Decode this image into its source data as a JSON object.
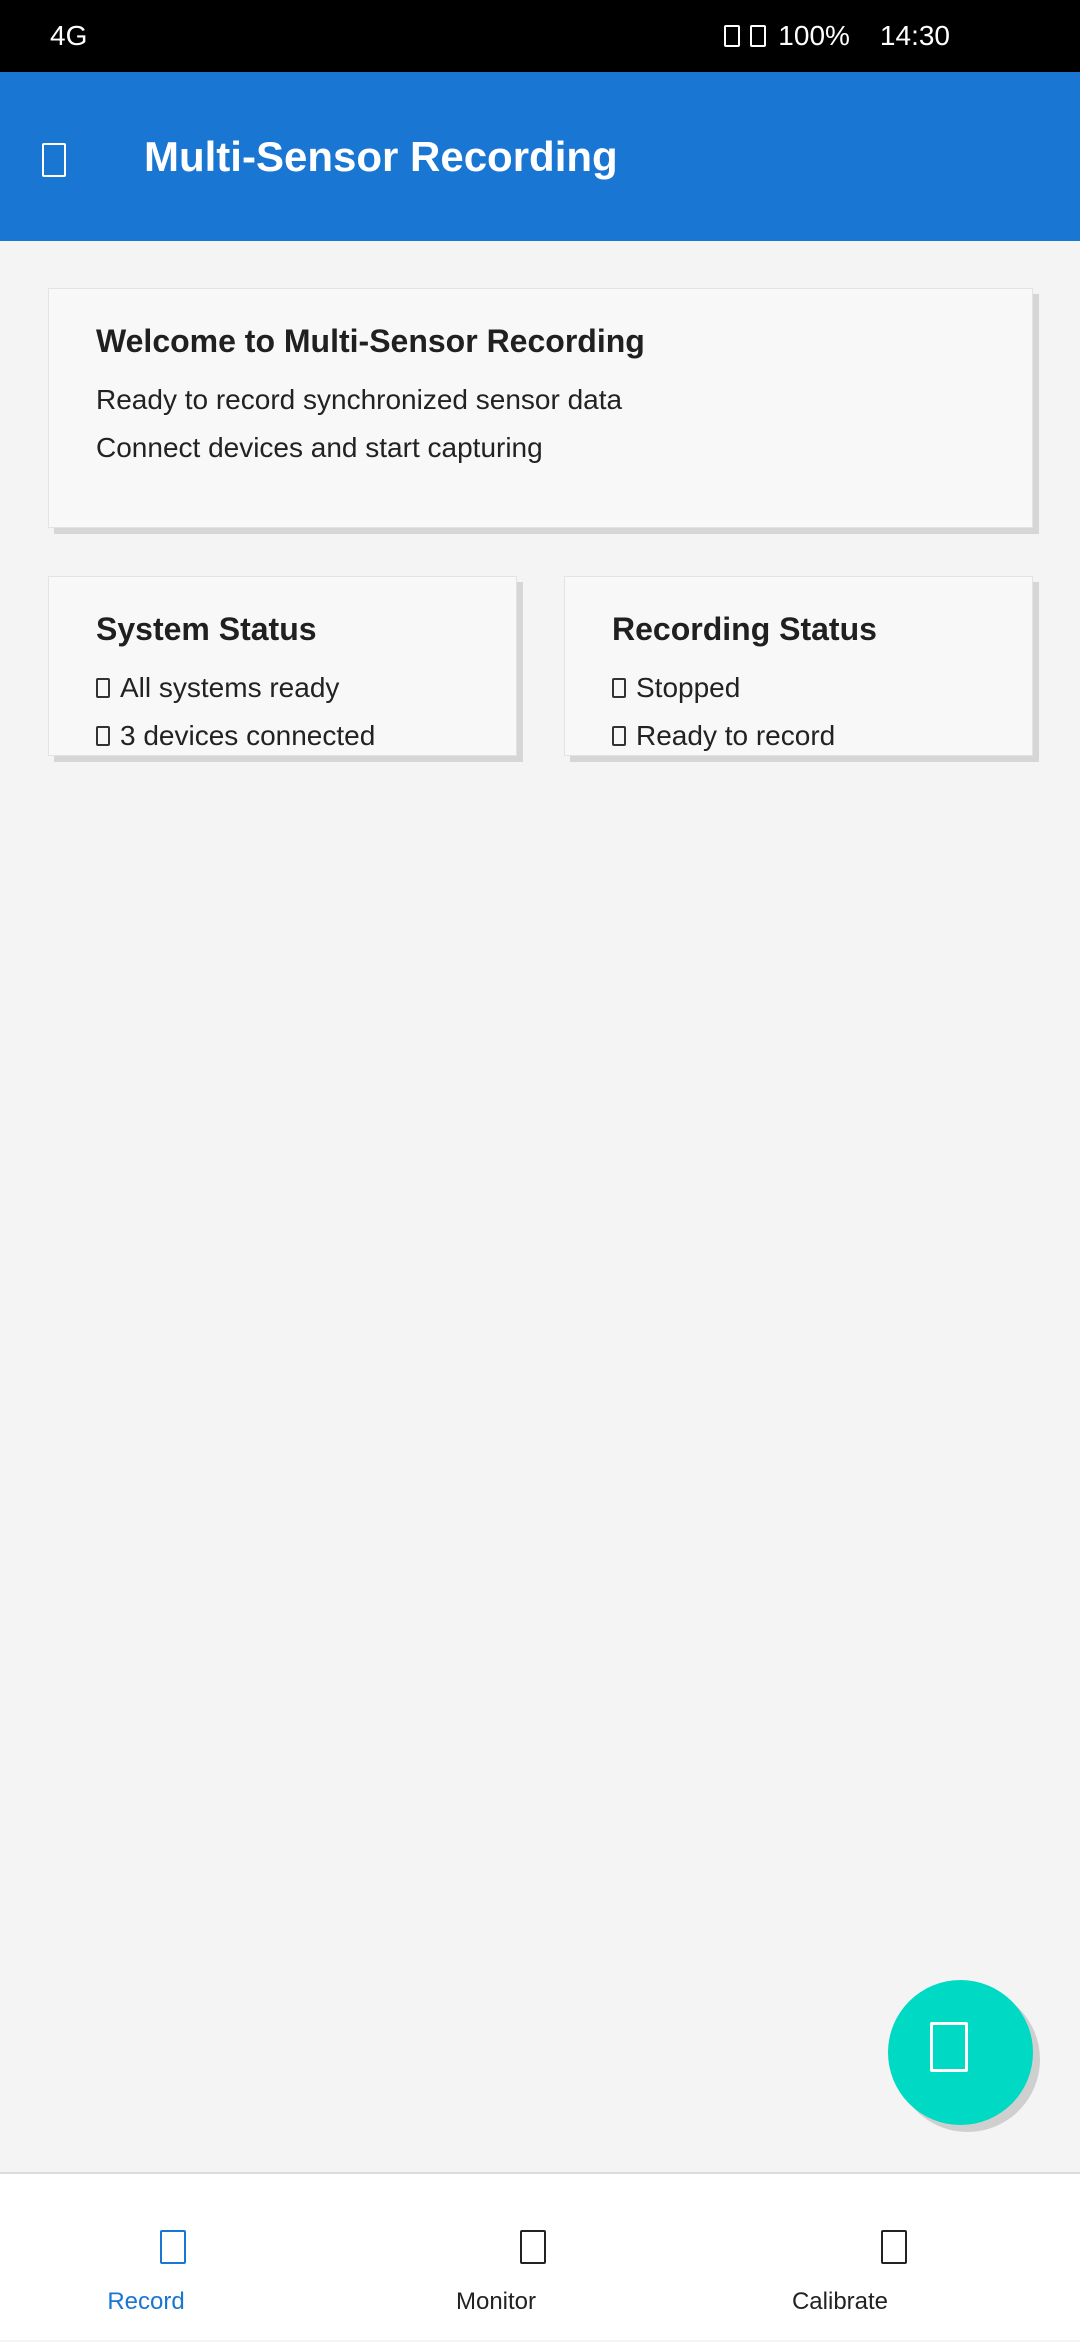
{
  "status_bar": {
    "network": "4G",
    "battery": "100%",
    "time": "14:30",
    "icons": [
      "signal-icon",
      "wifi-icon"
    ]
  },
  "app_bar": {
    "title": "Multi-Sensor Recording",
    "menu_icon": "menu-icon"
  },
  "welcome_card": {
    "title": "Welcome to Multi-Sensor Recording",
    "lines": [
      "Ready to record synchronized sensor data",
      "Connect devices and start capturing"
    ]
  },
  "system_status": {
    "title": "System Status",
    "lines": [
      "All systems ready",
      "3 devices connected"
    ]
  },
  "recording_status": {
    "title": "Recording Status",
    "lines": [
      "Stopped",
      "Ready to record"
    ]
  },
  "fab": {
    "icon": "record-icon",
    "color": "#00d9c3"
  },
  "bottom_nav": {
    "items": [
      {
        "label": "Record",
        "icon": "record-icon",
        "active": true
      },
      {
        "label": "Monitor",
        "icon": "monitor-icon",
        "active": false
      },
      {
        "label": "Calibrate",
        "icon": "calibrate-icon",
        "active": false
      }
    ]
  },
  "colors": {
    "primary": "#1976d2",
    "accent": "#00d9c3",
    "background": "#f4f4f4"
  }
}
